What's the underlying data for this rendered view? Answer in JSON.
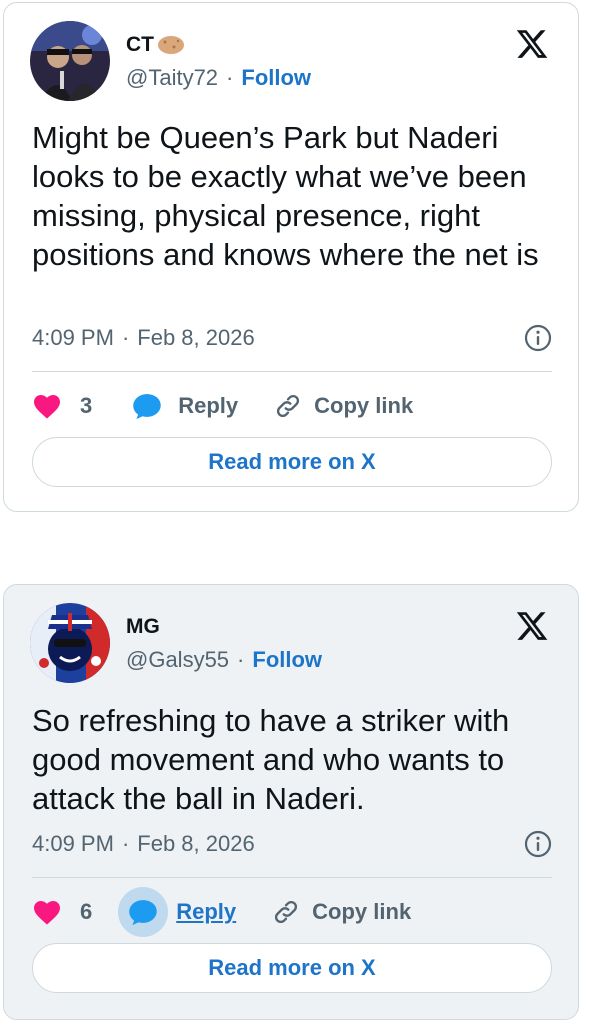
{
  "tweets": [
    {
      "author_name": "CT",
      "handle": "@Taity72",
      "separator": "·",
      "follow_label": "Follow",
      "text": "Might be Queen’s Park but Naderi looks to be exactly what we’ve been missing, physical presence, right positions and knows where the net is",
      "time": "4:09 PM",
      "date": "Feb 8, 2026",
      "likes": "3",
      "reply_label": "Reply",
      "copy_label": "Copy link",
      "read_more_label": "Read more on X",
      "avatar_icon": "avatar-photo",
      "name_emoji_icon": "potato-emoji-icon"
    },
    {
      "author_name": "MG",
      "handle": "@Galsy55",
      "separator": "·",
      "follow_label": "Follow",
      "text": "So refreshing to have a striker with good movement and who wants to attack the ball in Naderi.",
      "time": "4:09 PM",
      "date": "Feb 8, 2026",
      "likes": "6",
      "reply_label": "Reply",
      "copy_label": "Copy link",
      "read_more_label": "Read more on X",
      "avatar_icon": "avatar-union-jack-character"
    }
  ],
  "colors": {
    "accent": "#1d74c9",
    "like": "#f91880",
    "reply_bubble": "#1d9bf0",
    "muted": "#536471",
    "border": "#cfd9de"
  }
}
